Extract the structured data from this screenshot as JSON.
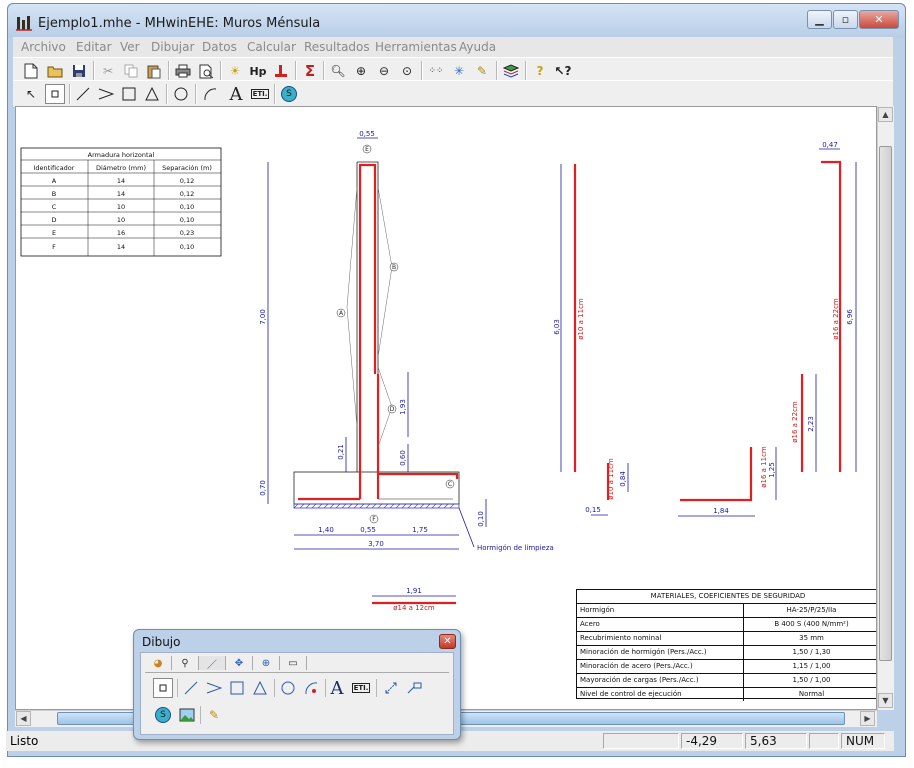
{
  "window": {
    "title": "Ejemplo1.mhe - MHwinEHE: Muros Ménsula"
  },
  "menu": [
    "Archivo",
    "Editar",
    "Ver",
    "Dibujar",
    "Datos",
    "Calcular",
    "Resultados",
    "Herramientas",
    "Ayuda"
  ],
  "toolbar1": {
    "hp_label": "Hp",
    "sigma_label": "Σ",
    "help_label": "?"
  },
  "toolbar2": {
    "text_tool_label": "A",
    "label_tool_label": "ETI.",
    "symbol_label": "S"
  },
  "colors": {
    "accent_red": "#e02020",
    "dim_blue": "#1a1aa8",
    "hatch_blue": "#3a3ad8"
  },
  "table_horizontal": {
    "title": "Armadura horizontal",
    "headers": [
      "Identificador",
      "Diámetro (mm)",
      "Separación (m)"
    ],
    "rows": [
      [
        "A",
        "14",
        "0,12"
      ],
      [
        "B",
        "14",
        "0,12"
      ],
      [
        "C",
        "10",
        "0,10"
      ],
      [
        "D",
        "10",
        "0,10"
      ],
      [
        "E",
        "16",
        "0,23"
      ],
      [
        "F",
        "14",
        "0,10"
      ]
    ]
  },
  "drawing": {
    "dims": {
      "top_width": "0,55",
      "wall_height": "7,00",
      "footing_height": "0,70",
      "d_021": "0,21",
      "d_060": "0,60",
      "d_193": "1,93",
      "d_010": "0,10",
      "base_left": "1,40",
      "base_mid": "0,55",
      "base_right": "1,75",
      "base_total": "3,70",
      "bar_len_191": "1,91",
      "bar_191_label": "ø14 a 12cm",
      "limpieza": "Hormigón de limpieza",
      "bar_603": "6,03",
      "bar_603_label": "ø10 a 11cm",
      "bar_small_label": "ø10 a 11cm",
      "bar_084": "0,84",
      "bar_015": "0,15",
      "bar_184": "1,84",
      "bar_125": "1,25",
      "bar_l_label": "ø16 a 11cm",
      "bar_223": "2,23",
      "bar_223_label": "ø16 a 22cm",
      "bar_047": "0,47",
      "bar_696": "6,96",
      "bar_696_label": "ø16 a 22cm"
    },
    "circle_labels": [
      "A",
      "B",
      "C",
      "D",
      "E",
      "F"
    ]
  },
  "materials_table": {
    "title": "MATERIALES, COEFICIENTES DE SEGURIDAD",
    "rows": [
      [
        "Hormigón",
        "HA-25/P/25/IIa"
      ],
      [
        "Acero",
        "B 400 S (400 N/mm²)"
      ],
      [
        "Recubrimiento nominal",
        "35 mm"
      ],
      [
        "Minoración de hormigón (Pers./Acc.)",
        "1,50 / 1,30"
      ],
      [
        "Minoración de acero (Pers./Acc.)",
        "1,15 / 1,00"
      ],
      [
        "Mayoración de cargas (Pers./Acc.)",
        "1,50 / 1,00"
      ],
      [
        "Nivel de control de ejecución",
        "Normal"
      ]
    ]
  },
  "status": {
    "text": "Listo",
    "x": "-4,29",
    "y": "5,63",
    "num": "NUM"
  },
  "dibujo_panel": {
    "title": "Dibujo",
    "text_tool_label": "A",
    "label_tool_label": "ETI.",
    "symbol_label": "S"
  }
}
